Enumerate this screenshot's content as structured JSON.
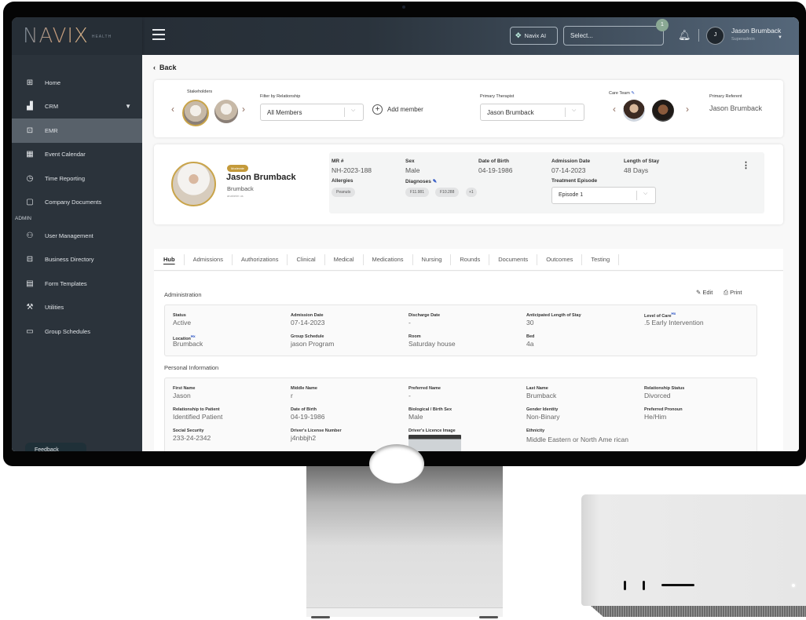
{
  "app": {
    "logo": "NAVIX",
    "logo_sub": "HEALTH"
  },
  "topbar": {
    "ai_button": "Navix AI",
    "select_placeholder": "Select...",
    "notification_count": "1",
    "user_initial": "J",
    "user_name": "Jason Brumback",
    "user_role": "Superadmin"
  },
  "sidebar": {
    "items": [
      {
        "label": "Home",
        "icon": "home-icon"
      },
      {
        "label": "CRM",
        "icon": "chart-icon"
      },
      {
        "label": "EMR",
        "icon": "folder-icon"
      },
      {
        "label": "Event Calendar",
        "icon": "calendar-icon"
      },
      {
        "label": "Time Reporting",
        "icon": "clock-icon"
      },
      {
        "label": "Company Documents",
        "icon": "document-icon"
      }
    ],
    "section_admin": "ADMIN",
    "admin_items": [
      {
        "label": "User Management",
        "icon": "users-icon"
      },
      {
        "label": "Business Directory",
        "icon": "briefcase-icon"
      },
      {
        "label": "Form Templates",
        "icon": "form-icon"
      },
      {
        "label": "Utilities",
        "icon": "wrench-icon"
      },
      {
        "label": "Group Schedules",
        "icon": "monitor-icon"
      }
    ],
    "feedback": "Feedback"
  },
  "page": {
    "back": "Back",
    "stakeholders": {
      "label": "Stakeholders",
      "filter_label": "Filter by Relationship",
      "filter_value": "All Members",
      "add_member": "Add member",
      "primary_therapist_label": "Primary Therapist",
      "primary_therapist_value": "Jason Brumback",
      "care_team_label": "Care Team",
      "primary_referent_label": "Primary Referent",
      "primary_referent_value": "Jason Brumback"
    },
    "patient": {
      "badge": "Moderate",
      "name": "Jason Brumback",
      "surname": "Brumback",
      "location": "anaheim us",
      "mr_label": "MR #",
      "mr_value": "NH-2023-188",
      "sex_label": "Sex",
      "sex_value": "Male",
      "dob_label": "Date of Birth",
      "dob_value": "04-19-1986",
      "admission_label": "Admission Date",
      "admission_value": "07-14-2023",
      "los_label": "Length of Stay",
      "los_value": "48 Days",
      "allergies_label": "Allergies",
      "allergies": [
        "Peanuts"
      ],
      "diagnoses_label": "Diagnoses",
      "diagnoses": [
        "F11.981",
        "F10.288",
        "+1"
      ],
      "episode_label": "Treatment Episode",
      "episode_value": "Episode 1"
    },
    "tabs": [
      "Hub",
      "Admissions",
      "Authorizations",
      "Clinical",
      "Medical",
      "Medications",
      "Nursing",
      "Rounds",
      "Documents",
      "Outcomes",
      "Testing"
    ],
    "active_tab": "Hub",
    "administration": {
      "title": "Administration",
      "edit": "Edit",
      "print": "Print",
      "fields": {
        "status": {
          "label": "Status",
          "value": "Active"
        },
        "admission_date": {
          "label": "Admission Date",
          "value": "07-14-2023"
        },
        "discharge_date": {
          "label": "Discharge Date",
          "value": "-"
        },
        "anticipated_los": {
          "label": "Anticipated Length of Stay",
          "value": "30"
        },
        "level_of_care": {
          "label": "Level of Care",
          "value": ".5 Early Intervention"
        },
        "location": {
          "label": "Location",
          "value": "Brumback"
        },
        "group_schedule": {
          "label": "Group Schedule",
          "value": "jason Program"
        },
        "room": {
          "label": "Room",
          "value": "Saturday house"
        },
        "bed": {
          "label": "Bed",
          "value": "4a"
        }
      },
      "hx": "Hx"
    },
    "personal": {
      "title": "Personal Information",
      "fields": {
        "first_name": {
          "label": "First Name",
          "value": "Jason"
        },
        "middle_name": {
          "label": "Middle Name",
          "value": "r"
        },
        "preferred_name": {
          "label": "Preferred Name",
          "value": "-"
        },
        "last_name": {
          "label": "Last Name",
          "value": "Brumback"
        },
        "relationship_status": {
          "label": "Relationship Status",
          "value": "Divorced"
        },
        "relationship_to_patient": {
          "label": "Relationship to Patient",
          "value": "Identified Patient"
        },
        "dob": {
          "label": "Date of Birth",
          "value": "04-19-1986"
        },
        "bio_sex": {
          "label": "Biological / Birth Sex",
          "value": "Male"
        },
        "gender_identity": {
          "label": "Gender Identity",
          "value": "Non-Binary"
        },
        "pronoun": {
          "label": "Preferred Pronoun",
          "value": "He/Him"
        },
        "ssn": {
          "label": "Social Security",
          "value": "233-24-2342"
        },
        "license_number": {
          "label": "Driver's License Number",
          "value": "j4nbbjh2"
        },
        "license_image": {
          "label": "Driver's Licence Image"
        },
        "ethnicity": {
          "label": "Ethnicity",
          "value": "Middle Eastern or North Ame rican"
        }
      }
    }
  },
  "colors": {
    "accent_gold": "#c49a3a",
    "sidebar_bg": "#2b333b",
    "sidebar_active": "#58616a",
    "hx_blue": "#2952c4"
  }
}
